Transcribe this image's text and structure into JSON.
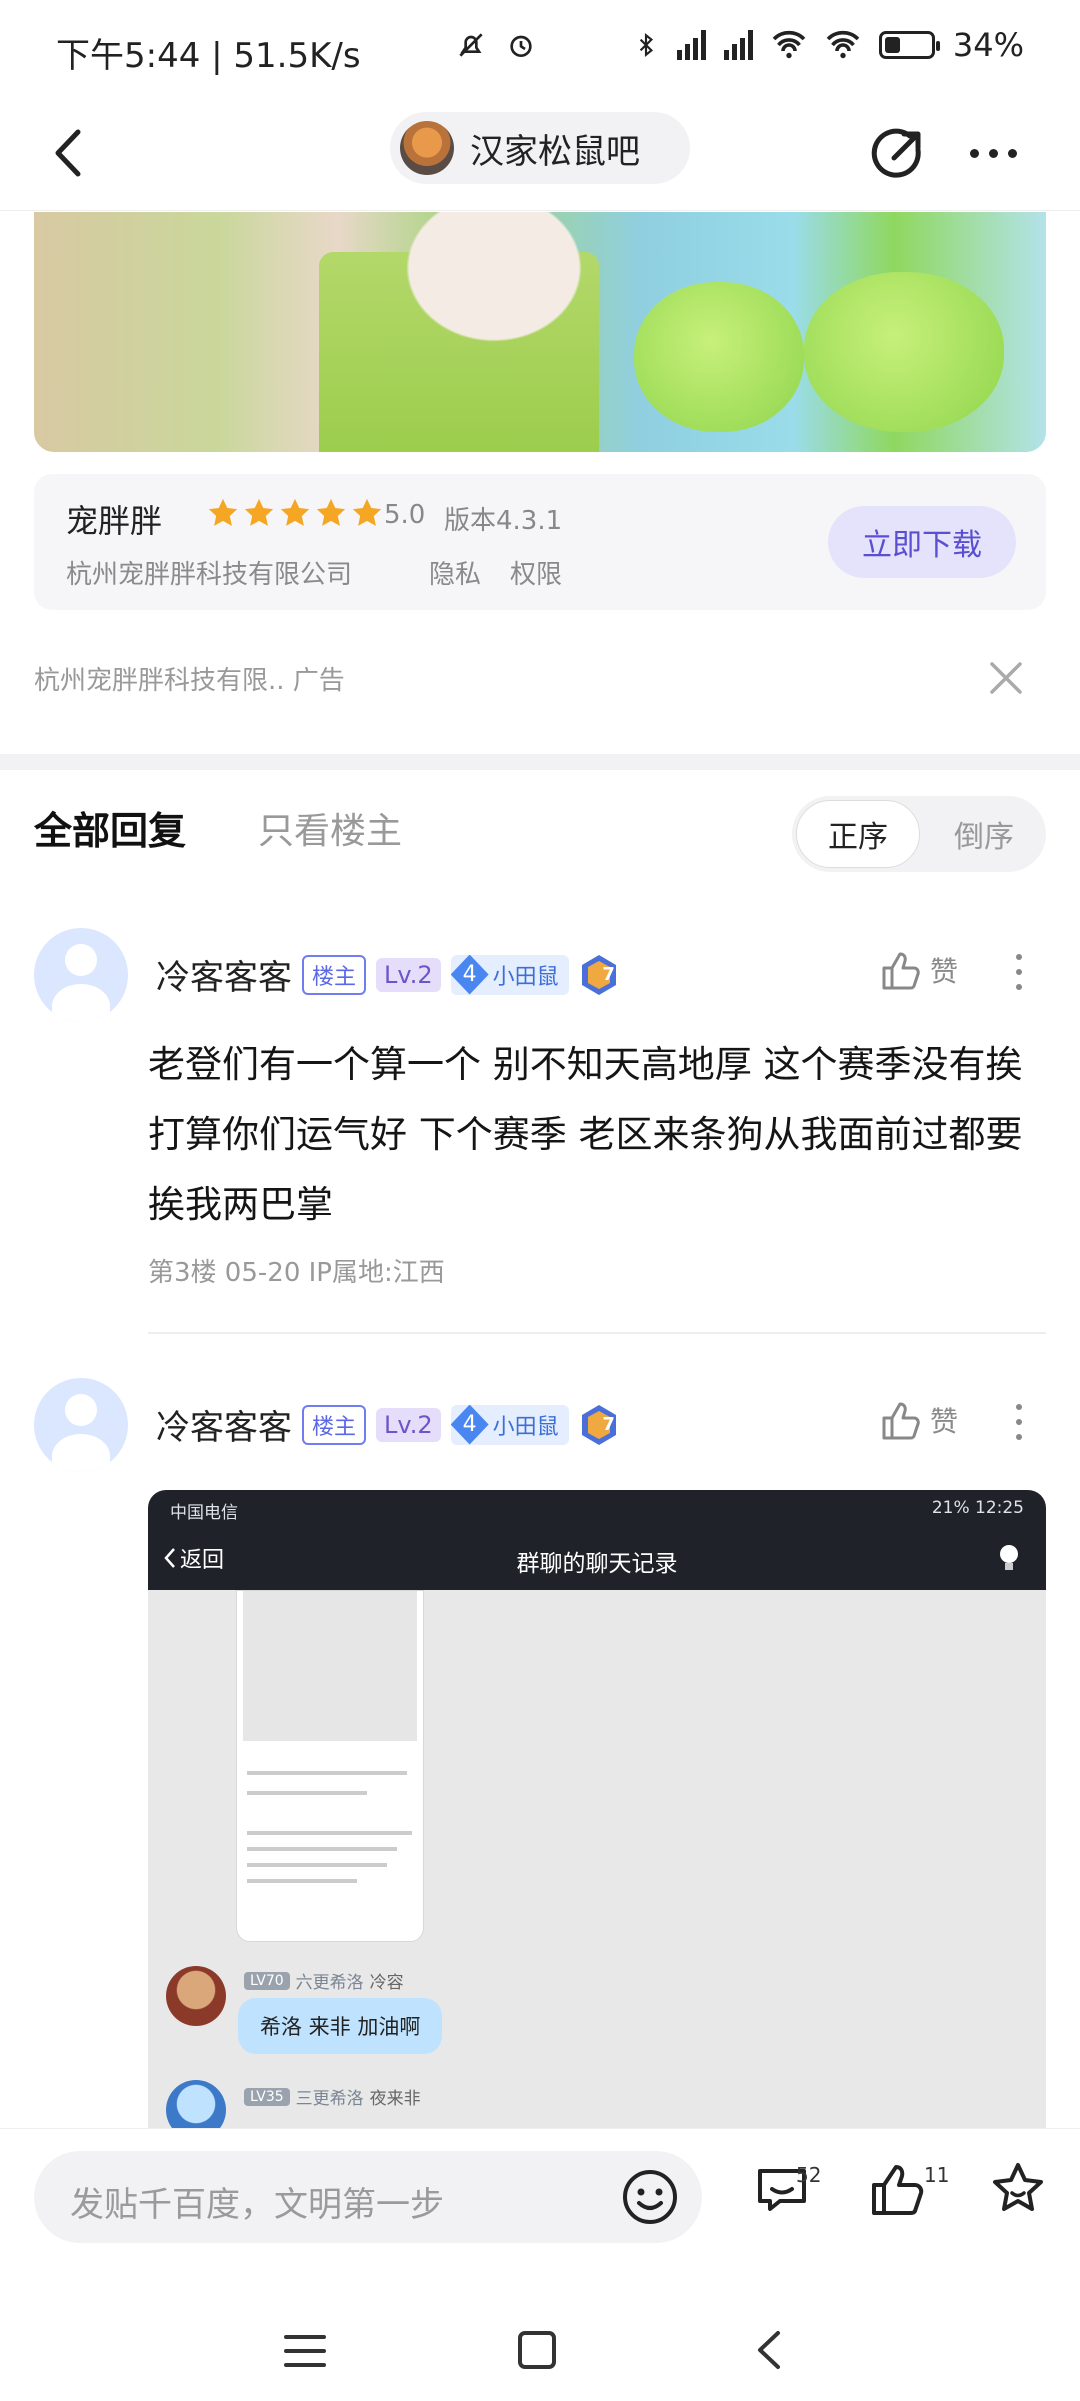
{
  "status_bar": {
    "time_speed": "下午5:44 | 51.5K/s",
    "battery": "34%",
    "battery_level": 0.34,
    "icons": [
      "mute-bell-icon",
      "alarm-icon",
      "bluetooth-icon",
      "signal-hd-icon",
      "signal-hd-icon",
      "wifi-plus-icon",
      "wifi-icon",
      "battery-icon"
    ]
  },
  "nav": {
    "forum_name": "汉家松鼠吧"
  },
  "ad": {
    "app_name": "宠胖胖",
    "rating": "5.0",
    "version": "版本4.3.1",
    "company": "杭州宠胖胖科技有限公司",
    "privacy": "隐私",
    "permission": "权限",
    "download": "立即下载",
    "sponsor_line": "杭州宠胖胖科技有限.. 广告",
    "stars": 5
  },
  "tabs": {
    "all": "全部回复",
    "op_only": "只看楼主",
    "order_asc": "正序",
    "order_desc": "倒序"
  },
  "posts": [
    {
      "user": "冷客客客",
      "op_badge": "楼主",
      "level": "Lv.2",
      "group_num": "4",
      "group_name": "小田鼠",
      "medal_num": "7",
      "like_label": "赞",
      "text": "老登们有一个算一个 别不知天高地厚 这个赛季没有挨打算你们运气好 下个赛季 老区来条狗从我面前过都要挨我两巴掌",
      "meta": "第3楼  05-20  IP属地:江西"
    },
    {
      "user": "冷客客客",
      "op_badge": "楼主",
      "level": "Lv.2",
      "group_num": "4",
      "group_name": "小田鼠",
      "medal_num": "7",
      "like_label": "赞"
    }
  ],
  "screenshot": {
    "carrier": "中国电信",
    "status_right": "21%  12:25",
    "back": "返回",
    "title": "群聊的聊天记录",
    "msg1_level": "LV70",
    "msg1_title": "六更希洛",
    "msg1_name": "冷容",
    "msg1_text": "希洛 来非 加油啊",
    "msg2_level": "LV35",
    "msg2_title": "三更希洛",
    "msg2_name": "夜来非"
  },
  "bottom": {
    "placeholder": "发贴千百度，文明第一步",
    "comments": "52",
    "likes": "11"
  }
}
